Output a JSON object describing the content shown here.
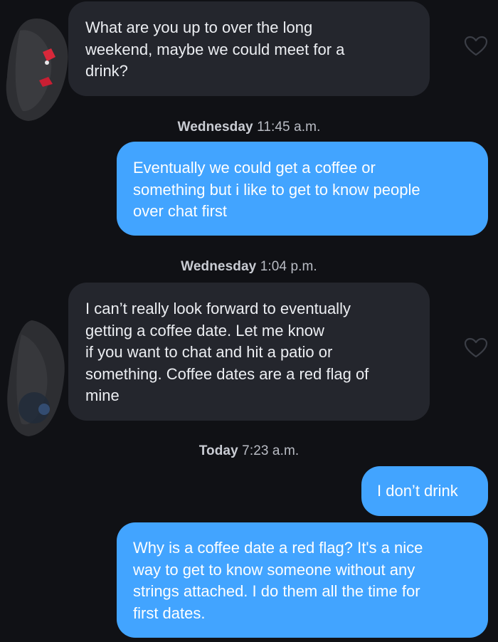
{
  "theme": {
    "background": "#101115",
    "incoming_bubble": "#24262d",
    "outgoing_bubble": "#42a4ff",
    "heart_color": "#3b3e46"
  },
  "messages": [
    {
      "sender": "match",
      "text": "What are you up to over the long\nweekend, maybe we could meet for a\ndrink?",
      "liked": false
    },
    {
      "sender": "me",
      "text": "Eventually we could get a coffee or\nsomething but i like to get to know people\nover chat first"
    },
    {
      "sender": "match",
      "text": "I can’t really look forward to eventually\ngetting a coffee date. Let me know\nif you want to chat and hit a patio or\nsomething. Coffee dates are a red flag of\nmine",
      "liked": false
    },
    {
      "sender": "me",
      "text": "I don’t drink"
    },
    {
      "sender": "me",
      "text": "Why is a coffee date a red flag? It's a nice\nway to get to know someone without any\nstrings attached. I do them all the time for\nfirst dates."
    }
  ],
  "timestamps": [
    {
      "day": "Wednesday",
      "time": "11:45 a.m."
    },
    {
      "day": "Wednesday",
      "time": "1:04 p.m."
    },
    {
      "day": "Today",
      "time": "7:23 a.m."
    }
  ],
  "icons": {
    "like": "heart-outline-icon",
    "avatar": "redacted-avatar"
  }
}
